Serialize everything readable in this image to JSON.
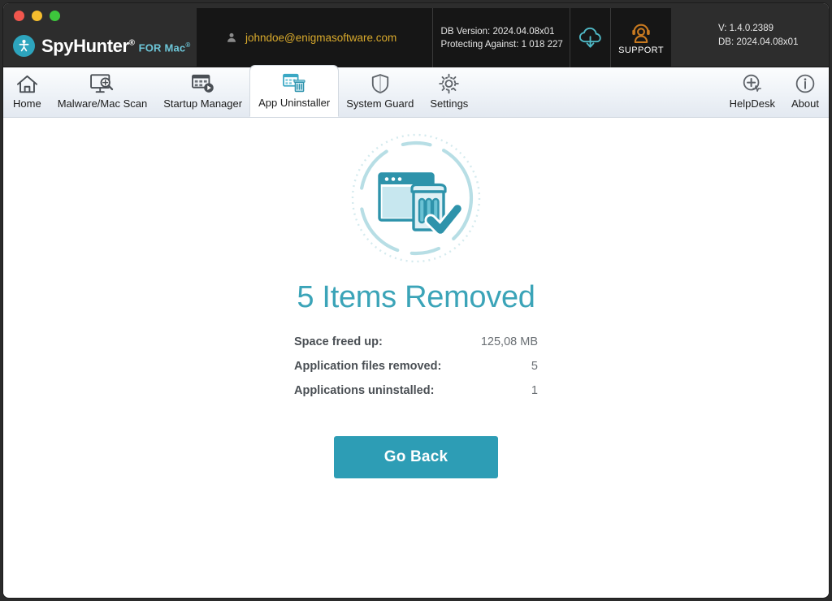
{
  "window": {
    "traffic_lights": [
      {
        "name": "close",
        "color": "#f1564d"
      },
      {
        "name": "minimize",
        "color": "#f5bd2e"
      },
      {
        "name": "maximize",
        "color": "#3dc63c"
      }
    ]
  },
  "brand": {
    "name": "SpyHunter",
    "name_mark": "®",
    "sub": "FOR Mac",
    "sub_mark": "®",
    "logo_icon": "spyhunter-person-icon"
  },
  "header": {
    "account_email": "johndoe@enigmasoftware.com",
    "account_icon": "user-icon",
    "db_version_line": "DB Version: 2024.04.08x01",
    "protecting_line": "Protecting Against: 1 018 227",
    "cloud_icon": "cloud-download-icon",
    "support_icon": "support-headset-icon",
    "support_label": "SUPPORT",
    "version_line": "V: 1.4.0.2389",
    "db_line": "DB:  2024.04.08x01"
  },
  "nav": {
    "tabs": [
      {
        "label": "Home",
        "icon": "home-icon",
        "active": false
      },
      {
        "label": "Malware/Mac Scan",
        "icon": "monitor-search-icon",
        "active": false
      },
      {
        "label": "Startup Manager",
        "icon": "startup-play-icon",
        "active": false
      },
      {
        "label": "App Uninstaller",
        "icon": "app-uninstaller-icon",
        "active": true
      },
      {
        "label": "System Guard",
        "icon": "shield-icon",
        "active": false
      },
      {
        "label": "Settings",
        "icon": "gear-icon",
        "active": false
      }
    ],
    "right_tabs": [
      {
        "label": "HelpDesk",
        "icon": "helpdesk-pulse-icon",
        "active": false
      },
      {
        "label": "About",
        "icon": "info-icon",
        "active": false
      }
    ]
  },
  "main": {
    "hero_icon": "window-trash-check-icon",
    "title": "5 Items Removed",
    "stats": [
      {
        "label": "Space freed up:",
        "value": "125,08 MB"
      },
      {
        "label": "Application files removed:",
        "value": "5"
      },
      {
        "label": "Applications uninstalled:",
        "value": "1"
      }
    ],
    "go_back_label": "Go Back"
  },
  "colors": {
    "accent_teal": "#2d9db5",
    "title_teal": "#3ba4b8",
    "account_amber": "#d8a92c",
    "support_orange": "#c97a20",
    "titlebar_bg": "#2d2d2d",
    "info_strip_bg": "#161616"
  }
}
